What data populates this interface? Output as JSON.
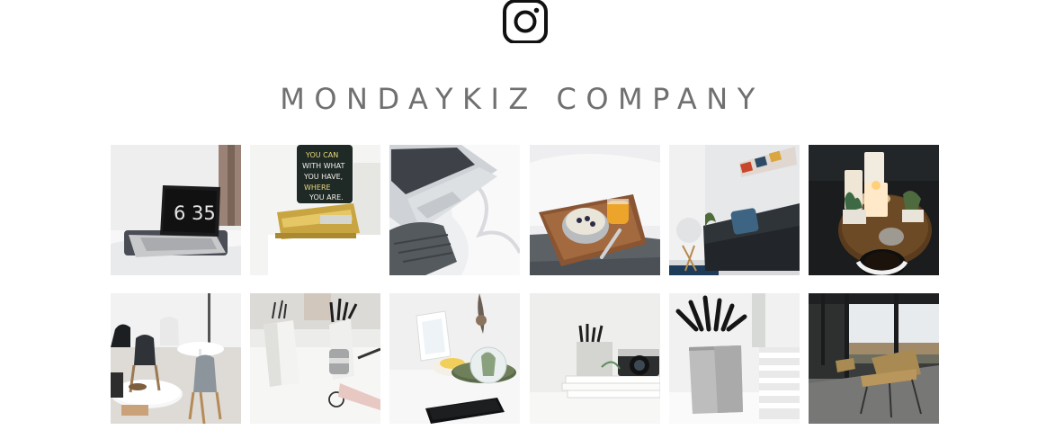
{
  "header": {
    "instagram_icon": "instagram-icon",
    "brand_name": "MONDAYKIZ COMPANY"
  },
  "feed": {
    "posts": [
      {
        "row": 1,
        "col": 1,
        "image": "laptop-flip-clock-on-bed",
        "clock_text": "6 35"
      },
      {
        "row": 1,
        "col": 2,
        "image": "gold-stapler-with-chalkboard-sign",
        "sign_text": "YOU CAN WITH WHAT YOU HAVE WHERE YOU ARE"
      },
      {
        "row": 1,
        "col": 3,
        "image": "laptop-on-white-sheets"
      },
      {
        "row": 1,
        "col": 4,
        "image": "breakfast-tray-on-bed"
      },
      {
        "row": 1,
        "col": 5,
        "image": "dark-sofa-living-room"
      },
      {
        "row": 1,
        "col": 6,
        "image": "candles-cactus-coffee-table"
      },
      {
        "row": 2,
        "col": 1,
        "image": "white-chairs-round-tables"
      },
      {
        "row": 2,
        "col": 2,
        "image": "desk-pen-holders"
      },
      {
        "row": 2,
        "col": 3,
        "image": "desk-with-phone-and-plant"
      },
      {
        "row": 2,
        "col": 4,
        "image": "camera-and-books-shelf"
      },
      {
        "row": 2,
        "col": 5,
        "image": "concrete-pencil-holder"
      },
      {
        "row": 2,
        "col": 6,
        "image": "office-chairs-by-window"
      }
    ]
  },
  "colors": {
    "brand_text": "#707070",
    "icon": "#111111"
  }
}
